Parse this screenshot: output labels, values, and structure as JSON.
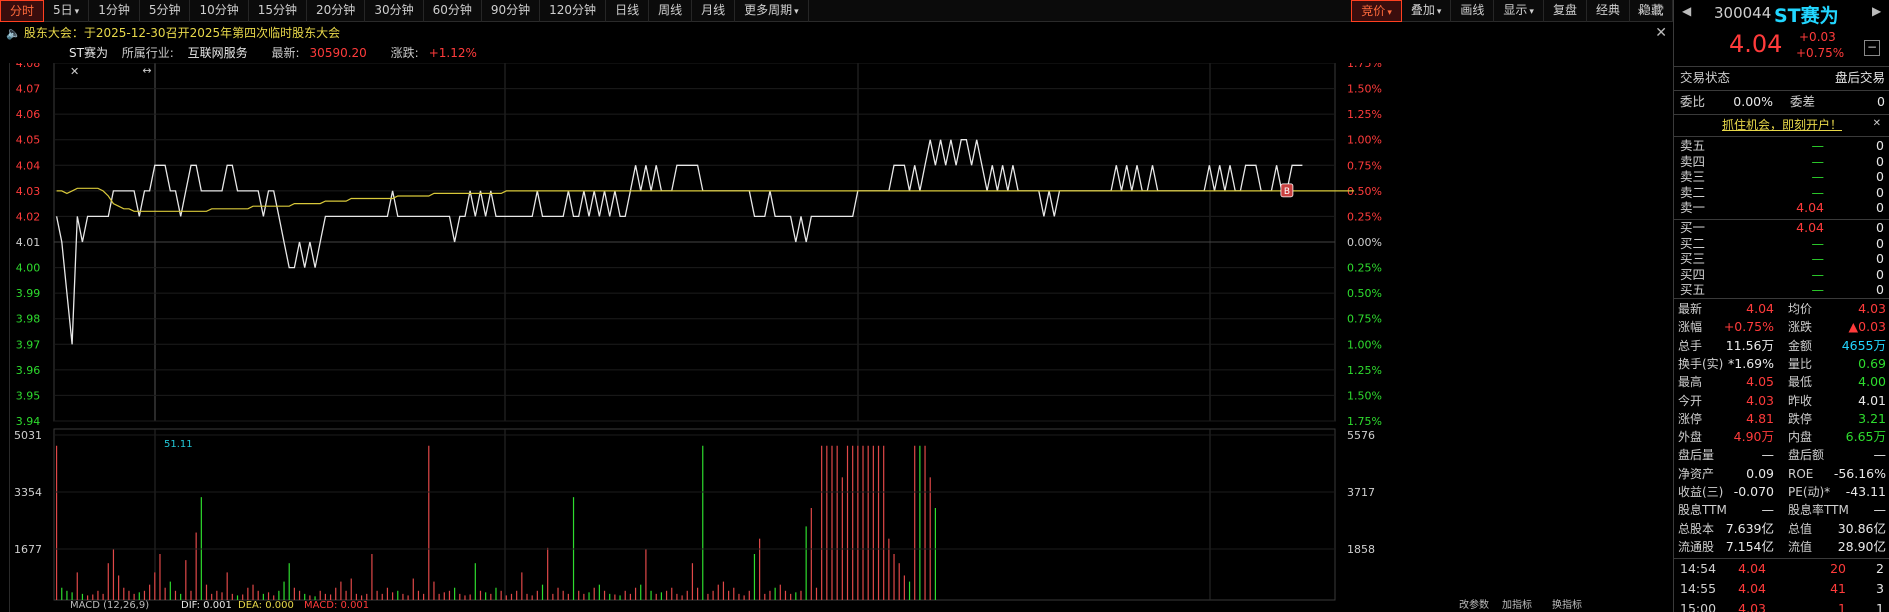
{
  "toolbar": {
    "periods": [
      "分时",
      "5日",
      "1分钟",
      "5分钟",
      "10分钟",
      "15分钟",
      "20分钟",
      "30分钟",
      "60分钟",
      "90分钟",
      "120分钟",
      "日线",
      "周线",
      "月线",
      "更多周期"
    ],
    "active_index": 0,
    "right_items": [
      "竞价",
      "叠加",
      "画线",
      "显示",
      "复盘",
      "经典",
      "隐藏"
    ]
  },
  "notice": {
    "text": "股东大会：于2025-12-30召开2025年第四次临时股东大会"
  },
  "info": {
    "name": "ST赛为",
    "industry_label": "所属行业:",
    "industry": "互联网服务",
    "latest_label": "最新:",
    "latest": "30590.20",
    "change_label": "涨跌:",
    "change": "+1.12%"
  },
  "price_axis": {
    "labels": [
      "4.08",
      "4.07",
      "4.06",
      "4.05",
      "4.04",
      "4.03",
      "4.02",
      "4.01",
      "4.00",
      "3.99",
      "3.98",
      "3.97",
      "3.96",
      "3.95",
      "3.94"
    ]
  },
  "pct_axis": {
    "labels": [
      "1.75%",
      "1.50%",
      "1.25%",
      "1.00%",
      "0.75%",
      "0.50%",
      "0.25%",
      "0.00%",
      "0.25%",
      "0.50%",
      "0.75%",
      "1.00%",
      "1.25%",
      "1.50%",
      "1.75%"
    ]
  },
  "volume_axis": {
    "left": [
      "5031",
      "3354",
      "1677"
    ],
    "right": [
      "5576",
      "3717",
      "1858"
    ],
    "ref_line": "51.11"
  },
  "chart_data": {
    "type": "line",
    "y_range": [
      3.94,
      4.08
    ],
    "prev_close": 4.01,
    "price": [
      4.02,
      4.01,
      3.99,
      3.97,
      4.02,
      4.01,
      4.02,
      4.02,
      4.02,
      4.02,
      4.02,
      4.03,
      4.03,
      4.03,
      4.03,
      4.03,
      4.02,
      4.03,
      4.03,
      4.04,
      4.04,
      4.04,
      4.03,
      4.03,
      4.02,
      4.03,
      4.04,
      4.04,
      4.03,
      4.03,
      4.03,
      4.03,
      4.03,
      4.04,
      4.04,
      4.03,
      4.03,
      4.03,
      4.03,
      4.03,
      4.02,
      4.03,
      4.03,
      4.02,
      4.01,
      4.0,
      4.0,
      4.01,
      4.0,
      4.01,
      4.0,
      4.01,
      4.02,
      4.02,
      4.02,
      4.02,
      4.02,
      4.02,
      4.02,
      4.02,
      4.02,
      4.02,
      4.02,
      4.02,
      4.02,
      4.03,
      4.02,
      4.02,
      4.02,
      4.02,
      4.02,
      4.02,
      4.02,
      4.02,
      4.02,
      4.02,
      4.02,
      4.01,
      4.02,
      4.02,
      4.03,
      4.02,
      4.03,
      4.02,
      4.03,
      4.02,
      4.02,
      4.02,
      4.02,
      4.02,
      4.02,
      4.02,
      4.02,
      4.03,
      4.02,
      4.02,
      4.02,
      4.02,
      4.02,
      4.03,
      4.02,
      4.02,
      4.03,
      4.02,
      4.03,
      4.02,
      4.03,
      4.02,
      4.03,
      4.02,
      4.02,
      4.03,
      4.04,
      4.03,
      4.04,
      4.03,
      4.04,
      4.03,
      4.03,
      4.03,
      4.04,
      4.04,
      4.04,
      4.04,
      4.04,
      4.03,
      4.03,
      4.03,
      4.03,
      4.03,
      4.03,
      4.03,
      4.03,
      4.03,
      4.03,
      4.02,
      4.02,
      4.02,
      4.03,
      4.02,
      4.02,
      4.02,
      4.02,
      4.01,
      4.02,
      4.01,
      4.02,
      4.02,
      4.02,
      4.02,
      4.02,
      4.02,
      4.02,
      4.02,
      4.02,
      4.03,
      4.03,
      4.03,
      4.03,
      4.03,
      4.03,
      4.03,
      4.04,
      4.04,
      4.04,
      4.03,
      4.04,
      4.03,
      4.04,
      4.05,
      4.04,
      4.05,
      4.04,
      4.05,
      4.04,
      4.05,
      4.05,
      4.04,
      4.05,
      4.04,
      4.03,
      4.04,
      4.03,
      4.04,
      4.03,
      4.04,
      4.03,
      4.03,
      4.03,
      4.03,
      4.03,
      4.02,
      4.03,
      4.02,
      4.03,
      4.03,
      4.03,
      4.03,
      4.03,
      4.03,
      4.03,
      4.03,
      4.03,
      4.03,
      4.03,
      4.04,
      4.03,
      4.04,
      4.03,
      4.04,
      4.03,
      4.03,
      4.04,
      4.03,
      4.03,
      4.03,
      4.03,
      4.03,
      4.03,
      4.03,
      4.03,
      4.03,
      4.03,
      4.04,
      4.03,
      4.04,
      4.03,
      4.04,
      4.03,
      4.03,
      4.04,
      4.04,
      4.04,
      4.03,
      4.03,
      4.03,
      4.04,
      4.03,
      4.03,
      4.04,
      4.04,
      4.04
    ],
    "avg": [
      4.03,
      4.03,
      4.029,
      4.03,
      4.031,
      4.031,
      4.031,
      4.031,
      4.031,
      4.03,
      4.028,
      4.025,
      4.024,
      4.023,
      4.023,
      4.022,
      4.022,
      4.022,
      4.022,
      4.022,
      4.022,
      4.022,
      4.022,
      4.022,
      4.022,
      4.022,
      4.022,
      4.022,
      4.022,
      4.022,
      4.023,
      4.023,
      4.023,
      4.023,
      4.023,
      4.023,
      4.023,
      4.023,
      4.024,
      4.024,
      4.024,
      4.024,
      4.024,
      4.024,
      4.024,
      4.024,
      4.025,
      4.025,
      4.025,
      4.025,
      4.025,
      4.025,
      4.026,
      4.026,
      4.026,
      4.026,
      4.026,
      4.027,
      4.027,
      4.027,
      4.027,
      4.027,
      4.027,
      4.027,
      4.027,
      4.027,
      4.028,
      4.028,
      4.028,
      4.028,
      4.028,
      4.028,
      4.028,
      4.029,
      4.029,
      4.029,
      4.029,
      4.029,
      4.029,
      4.029,
      4.029,
      4.029,
      4.029,
      4.029,
      4.029,
      4.029,
      4.029,
      4.03,
      4.03,
      4.03,
      4.03,
      4.03,
      4.03,
      4.03,
      4.03,
      4.03,
      4.03,
      4.03,
      4.03,
      4.03,
      4.03,
      4.03,
      4.03,
      4.03,
      4.03,
      4.03,
      4.03,
      4.03,
      4.03,
      4.03,
      4.03,
      4.03,
      4.03,
      4.03,
      4.03,
      4.03,
      4.03,
      4.03,
      4.03,
      4.03,
      4.03,
      4.03,
      4.03,
      4.03,
      4.03,
      4.03,
      4.03,
      4.03,
      4.03,
      4.03,
      4.03,
      4.03,
      4.03,
      4.03,
      4.03,
      4.03,
      4.03,
      4.03,
      4.03,
      4.03,
      4.03,
      4.03,
      4.03,
      4.03,
      4.03,
      4.03,
      4.03,
      4.03,
      4.03,
      4.03,
      4.03,
      4.03,
      4.03,
      4.03,
      4.03,
      4.03,
      4.03,
      4.03,
      4.03,
      4.03,
      4.03,
      4.03,
      4.03,
      4.03,
      4.03,
      4.03,
      4.03,
      4.03,
      4.03,
      4.03,
      4.03,
      4.03,
      4.03,
      4.03,
      4.03,
      4.03,
      4.03,
      4.03,
      4.03,
      4.03,
      4.03,
      4.03,
      4.03,
      4.03,
      4.03,
      4.03,
      4.03,
      4.03,
      4.03,
      4.03,
      4.03,
      4.03,
      4.03,
      4.03,
      4.03,
      4.03,
      4.03,
      4.03,
      4.03,
      4.03,
      4.03,
      4.03,
      4.03,
      4.03,
      4.03,
      4.03,
      4.03,
      4.03,
      4.03,
      4.03,
      4.03,
      4.03,
      4.03,
      4.03,
      4.03,
      4.03,
      4.03,
      4.03,
      4.03,
      4.03,
      4.03,
      4.03,
      4.03,
      4.03,
      4.03,
      4.03,
      4.03,
      4.03,
      4.03,
      4.03,
      4.03,
      4.03,
      4.03,
      4.03,
      4.03,
      4.03,
      4.03,
      4.03,
      4.03,
      4.03,
      4.03,
      4.03,
      4.03,
      4.03,
      4.03,
      4.03,
      4.03,
      4.03,
      4.03,
      4.03,
      4.03,
      4.03
    ],
    "volume": [
      5031,
      400,
      300,
      250,
      900,
      200,
      150,
      180,
      300,
      200,
      1200,
      1677,
      800,
      400,
      300,
      200,
      250,
      300,
      500,
      900,
      1500,
      400,
      600,
      300,
      200,
      1300,
      300,
      2200,
      3354,
      500,
      200,
      300,
      250,
      900,
      200,
      150,
      180,
      400,
      500,
      300,
      200,
      250,
      150,
      300,
      600,
      1200,
      400,
      300,
      200,
      150,
      120,
      300,
      200,
      180,
      400,
      600,
      300,
      700,
      200,
      150,
      200,
      1500,
      300,
      200,
      400,
      250,
      300,
      200,
      150,
      700,
      300,
      200,
      5031,
      600,
      200,
      250,
      300,
      400,
      200,
      150,
      180,
      1200,
      300,
      250,
      200,
      400,
      300,
      150,
      200,
      300,
      900,
      200,
      150,
      300,
      500,
      1700,
      200,
      400,
      300,
      200,
      3354,
      300,
      200,
      250,
      400,
      500,
      300,
      200,
      180,
      150,
      300,
      200,
      400,
      500,
      1677,
      300,
      200,
      250,
      300,
      400,
      200,
      150,
      300,
      1200,
      400,
      5031,
      200,
      300,
      500,
      600,
      300,
      400,
      200,
      150,
      300,
      1500,
      2000,
      200,
      300,
      400,
      500,
      300,
      200,
      250,
      300,
      2400,
      3000,
      400,
      5031,
      5031,
      5031,
      5031,
      4000,
      5031,
      5031,
      5031,
      5031,
      5031,
      5031,
      5031,
      5031,
      2000,
      1500,
      1200,
      800,
      600,
      5031,
      5031,
      5031,
      4000,
      3000
    ]
  },
  "macd": {
    "label": "MACD (12,26,9)",
    "dif": "DIF: 0.001",
    "dea": "DEA: 0.000",
    "macd": "MACD: 0.001",
    "right": [
      "改参数",
      "加指标",
      "换指标"
    ]
  },
  "quote": {
    "code": "300044",
    "name": "ST赛为",
    "price": "4.04",
    "chg": "+0.03",
    "pct": "+0.75%",
    "status_label": "交易状态",
    "status": "盘后交易",
    "wb_label": "委比",
    "wb": "0.00%",
    "wc_label": "委差",
    "wc": "0",
    "ad": "抓住机会，即刻开户！",
    "asks": [
      {
        "l": "卖五",
        "p": "—",
        "v": "0"
      },
      {
        "l": "卖四",
        "p": "—",
        "v": "0"
      },
      {
        "l": "卖三",
        "p": "—",
        "v": "0"
      },
      {
        "l": "卖二",
        "p": "—",
        "v": "0"
      },
      {
        "l": "卖一",
        "p": "4.04",
        "v": "0"
      }
    ],
    "bids": [
      {
        "l": "买一",
        "p": "4.04",
        "v": "0"
      },
      {
        "l": "买二",
        "p": "—",
        "v": "0"
      },
      {
        "l": "买三",
        "p": "—",
        "v": "0"
      },
      {
        "l": "买四",
        "p": "—",
        "v": "0"
      },
      {
        "l": "买五",
        "p": "—",
        "v": "0"
      }
    ],
    "stats": [
      {
        "l1": "最新",
        "v1": "4.04",
        "c1": "red",
        "l2": "均价",
        "v2": "4.03",
        "c2": "red"
      },
      {
        "l1": "涨幅",
        "v1": "+0.75%",
        "c1": "red",
        "l2": "涨跌",
        "v2": "▲0.03",
        "c2": "red"
      },
      {
        "l1": "总手",
        "v1": "11.56万",
        "c1": "white",
        "l2": "金额",
        "v2": "4655万",
        "c2": "cyan"
      },
      {
        "l1": "换手(实)",
        "v1": "*1.69%",
        "c1": "white",
        "l2": "量比",
        "v2": "0.69",
        "c2": "green"
      },
      {
        "l1": "最高",
        "v1": "4.05",
        "c1": "red",
        "l2": "最低",
        "v2": "4.00",
        "c2": "green"
      },
      {
        "l1": "今开",
        "v1": "4.03",
        "c1": "red",
        "l2": "昨收",
        "v2": "4.01",
        "c2": "white"
      },
      {
        "l1": "涨停",
        "v1": "4.81",
        "c1": "red",
        "l2": "跌停",
        "v2": "3.21",
        "c2": "green"
      },
      {
        "l1": "外盘",
        "v1": "4.90万",
        "c1": "red",
        "l2": "内盘",
        "v2": "6.65万",
        "c2": "green"
      },
      {
        "l1": "盘后量",
        "v1": "—",
        "c1": "white",
        "l2": "盘后额",
        "v2": "—",
        "c2": "white"
      },
      {
        "l1": "净资产",
        "v1": "0.09",
        "c1": "white",
        "l2": "ROE",
        "v2": "-56.16%",
        "c2": "white"
      },
      {
        "l1": "收益(三)",
        "v1": "-0.070",
        "c1": "white",
        "l2": "PE(动)*",
        "v2": "-43.11",
        "c2": "white"
      },
      {
        "l1": "股息TTM",
        "v1": "—",
        "c1": "white",
        "l2": "股息率TTM",
        "v2": "—",
        "c2": "white"
      },
      {
        "l1": "总股本",
        "v1": "7.639亿",
        "c1": "white",
        "l2": "总值",
        "v2": "30.86亿",
        "c2": "white"
      },
      {
        "l1": "流通股",
        "v1": "7.154亿",
        "c1": "white",
        "l2": "流值",
        "v2": "28.90亿",
        "c2": "white"
      }
    ],
    "ticks": [
      {
        "t": "14:54",
        "p": "4.04",
        "v": "20",
        "n": "2"
      },
      {
        "t": "14:55",
        "p": "4.04",
        "v": "41",
        "n": "3"
      },
      {
        "t": "15:00",
        "p": "4.03",
        "v": "1",
        "n": "1"
      }
    ]
  }
}
